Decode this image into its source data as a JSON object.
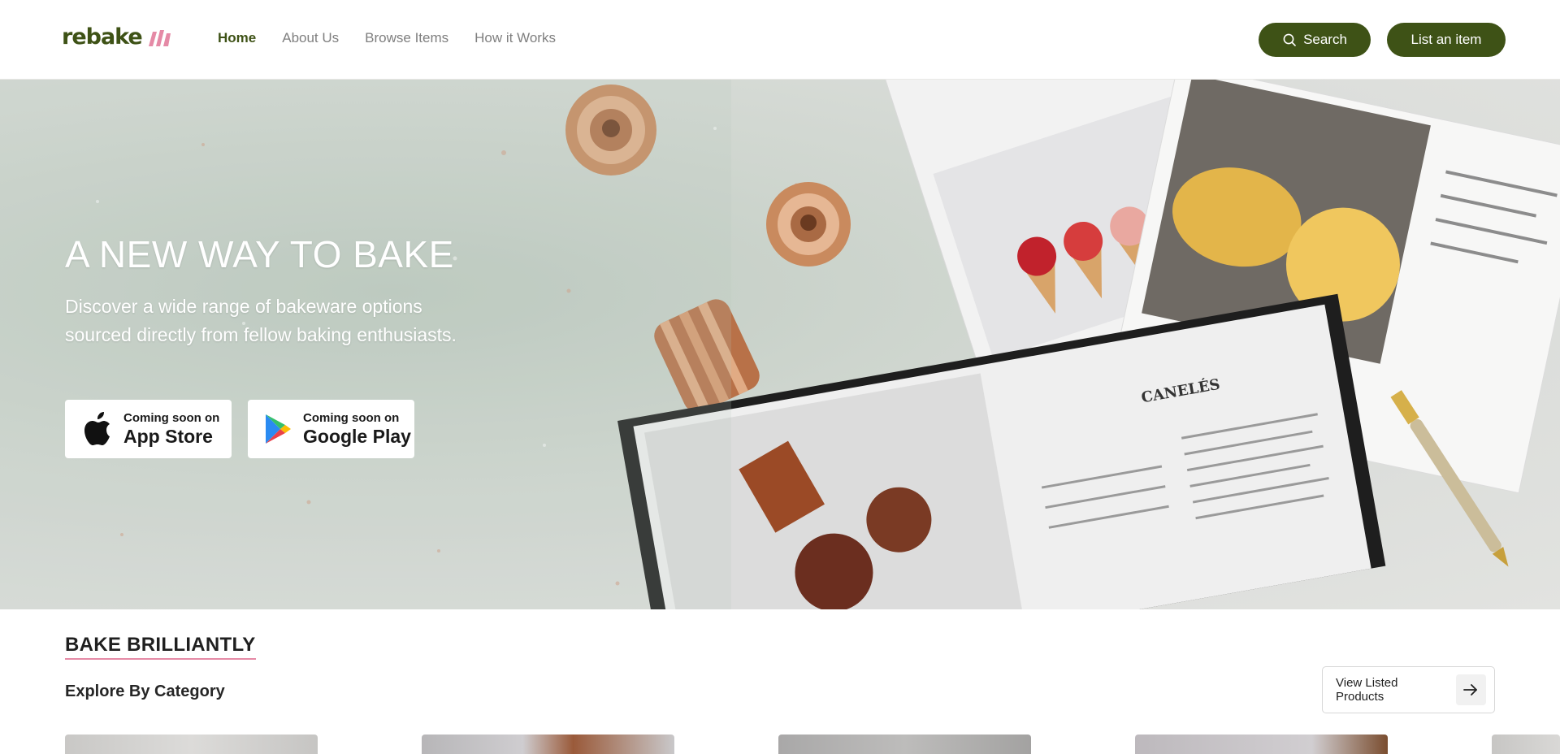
{
  "nav": {
    "brand": "rebake",
    "links": [
      {
        "label": "Home",
        "active": true
      },
      {
        "label": "About Us",
        "active": false
      },
      {
        "label": "Browse Items",
        "active": false
      },
      {
        "label": "How it Works",
        "active": false
      }
    ],
    "search_label": "Search",
    "list_label": "List an item"
  },
  "hero": {
    "title": "A NEW WAY TO BAKE",
    "subtitle": "Discover a wide range of bakeware options sourced directly from fellow baking enthusiasts.",
    "app_store": {
      "small": "Coming soon on",
      "big": "App Store"
    },
    "google_play": {
      "small": "Coming soon on",
      "big": "Google Play"
    }
  },
  "section": {
    "title": "BAKE BRILLIANTLY",
    "subtitle": "Explore By Category",
    "view_label": "View Listed Products"
  },
  "colors": {
    "brand": "#3e5216",
    "accent_pink": "#e58aa6",
    "nav_inactive": "#7f7f7f"
  },
  "icons": {
    "search": "search-icon",
    "apple": "apple-icon",
    "google_play": "google-play-icon",
    "arrow": "arrow-right-icon"
  }
}
